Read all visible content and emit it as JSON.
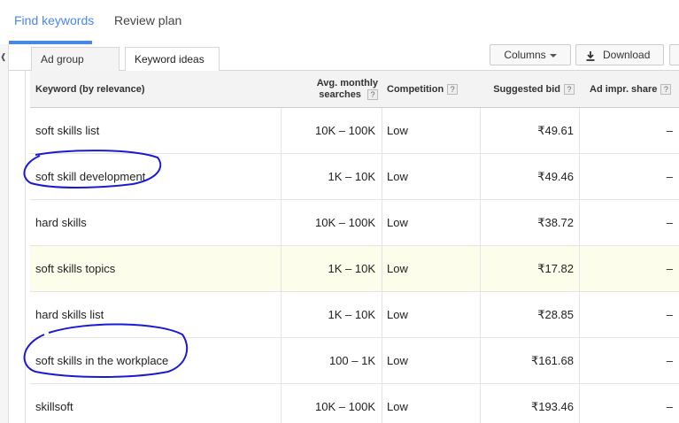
{
  "nav": {
    "tabs": [
      {
        "label": "Find keywords",
        "active": true
      },
      {
        "label": "Review plan",
        "active": false
      }
    ]
  },
  "toolbar": {
    "subtabs": [
      {
        "label": "Ad group ideas"
      },
      {
        "label": "Keyword ideas"
      }
    ],
    "columns_label": "Columns",
    "download_label": "Download"
  },
  "table": {
    "headers": {
      "keyword": "Keyword (by relevance)",
      "volume_line1": "Avg. monthly",
      "volume_line2": "searches",
      "competition": "Competition",
      "bid": "Suggested bid",
      "share": "Ad impr. share",
      "help": "?"
    },
    "rows": [
      {
        "keyword": "soft skills list",
        "volume": "10K – 100K",
        "competition": "Low",
        "bid": "₹49.61",
        "share": "–",
        "highlighted": false,
        "circled": false
      },
      {
        "keyword": "soft skill development",
        "volume": "1K – 10K",
        "competition": "Low",
        "bid": "₹49.46",
        "share": "–",
        "highlighted": false,
        "circled": true
      },
      {
        "keyword": "hard skills",
        "volume": "10K – 100K",
        "competition": "Low",
        "bid": "₹38.72",
        "share": "–",
        "highlighted": false,
        "circled": false
      },
      {
        "keyword": "soft skills topics",
        "volume": "1K – 10K",
        "competition": "Low",
        "bid": "₹17.82",
        "share": "–",
        "highlighted": true,
        "circled": false
      },
      {
        "keyword": "hard skills list",
        "volume": "1K – 10K",
        "competition": "Low",
        "bid": "₹28.85",
        "share": "–",
        "highlighted": false,
        "circled": false
      },
      {
        "keyword": "soft skills in the workplace",
        "volume": "100 – 1K",
        "competition": "Low",
        "bid": "₹161.68",
        "share": "–",
        "highlighted": false,
        "circled": true
      },
      {
        "keyword": "skillsoft",
        "volume": "10K – 100K",
        "competition": "Low",
        "bid": "₹193.46",
        "share": "–",
        "highlighted": false,
        "circled": false
      }
    ]
  },
  "colors": {
    "accent": "#4a86e8",
    "annotation": "#1a1ad6",
    "highlight_row": "#fdfdeb"
  }
}
